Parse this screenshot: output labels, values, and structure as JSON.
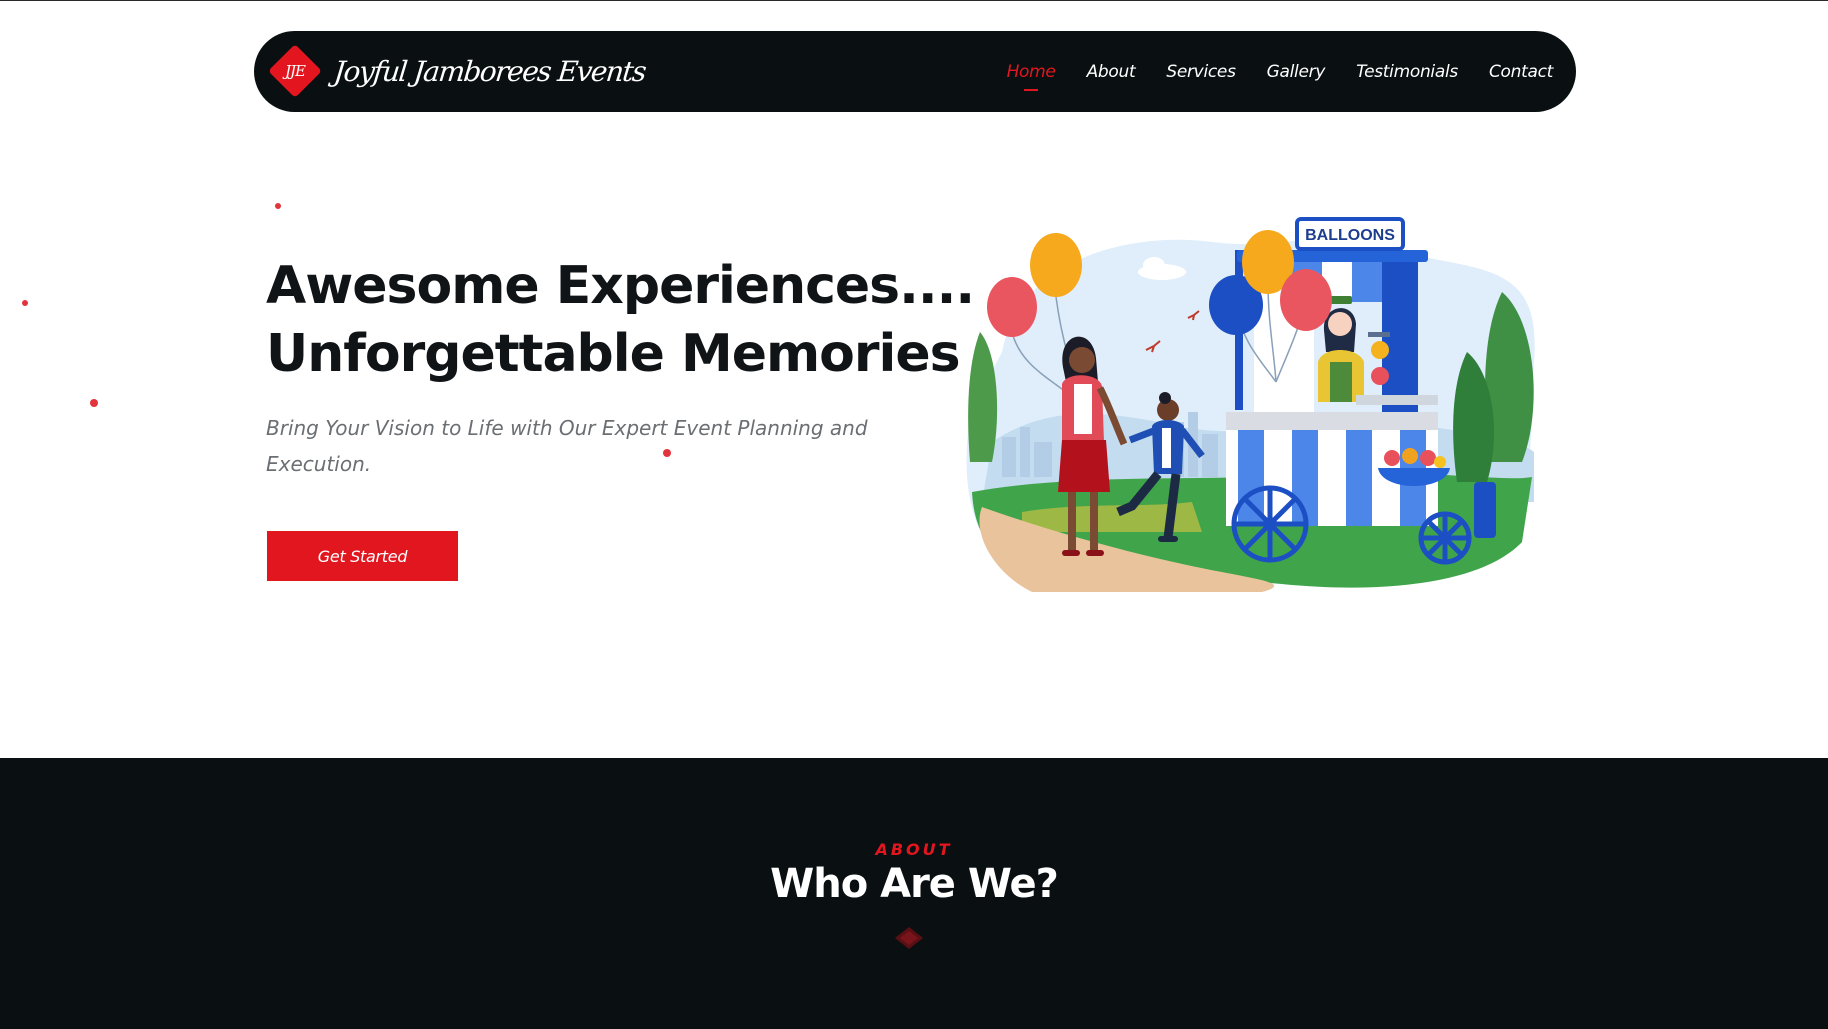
{
  "brand": {
    "badge_text": "JJE",
    "name": "Joyful Jamborees Events",
    "accent_color": "#e3161f",
    "dark_color": "#0a0f12"
  },
  "nav": {
    "items": [
      {
        "label": "Home",
        "active": true
      },
      {
        "label": "About",
        "active": false
      },
      {
        "label": "Services",
        "active": false
      },
      {
        "label": "Gallery",
        "active": false
      },
      {
        "label": "Testimonials",
        "active": false
      },
      {
        "label": "Contact",
        "active": false
      }
    ]
  },
  "hero": {
    "title_line1": "Awesome Experiences....",
    "title_line2": "Unforgettable Memories",
    "subtitle": "Bring Your Vision to Life with Our Expert Event Planning and Execution.",
    "cta_label": "Get Started",
    "illustration": {
      "sign_text": "BALLOONS",
      "icon": "balloon-stand-illustration"
    }
  },
  "about": {
    "eyebrow": "ABOUT",
    "title": "Who Are We?",
    "ornament_icon": "diamond-ornament-icon"
  }
}
